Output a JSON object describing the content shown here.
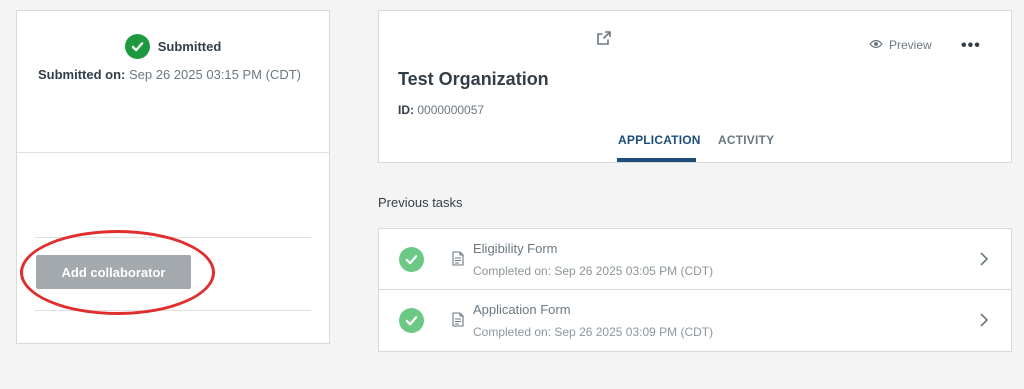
{
  "status_panel": {
    "status_label": "Submitted",
    "submitted_on_label": "Submitted on:",
    "submitted_on_value": "Sep 26 2025 03:15 PM (CDT)",
    "add_collaborator_label": "Add collaborator"
  },
  "org_card": {
    "preview_label": "Preview",
    "more_label": "•••",
    "title": "Test Organization",
    "id_label": "ID:",
    "id_value": "0000000057",
    "tabs": [
      {
        "label": "APPLICATION",
        "active": true
      },
      {
        "label": "ACTIVITY",
        "active": false
      }
    ]
  },
  "previous_tasks": {
    "title": "Previous tasks",
    "items": [
      {
        "name": "Eligibility Form",
        "completed": "Completed on: Sep 26 2025 03:05 PM (CDT)"
      },
      {
        "name": "Application Form",
        "completed": "Completed on: Sep 26 2025 03:09 PM (CDT)"
      }
    ]
  },
  "colors": {
    "status_green": "#1d9a3f",
    "task_check_green": "#6cc985",
    "active_tab": "#1d4e7a",
    "annotation_red": "#e02d2d",
    "disabled_button": "#a4a9ad"
  },
  "icons": [
    "check-circle-icon",
    "external-link-icon",
    "eye-icon",
    "more-icon",
    "document-icon",
    "chevron-right-icon"
  ]
}
